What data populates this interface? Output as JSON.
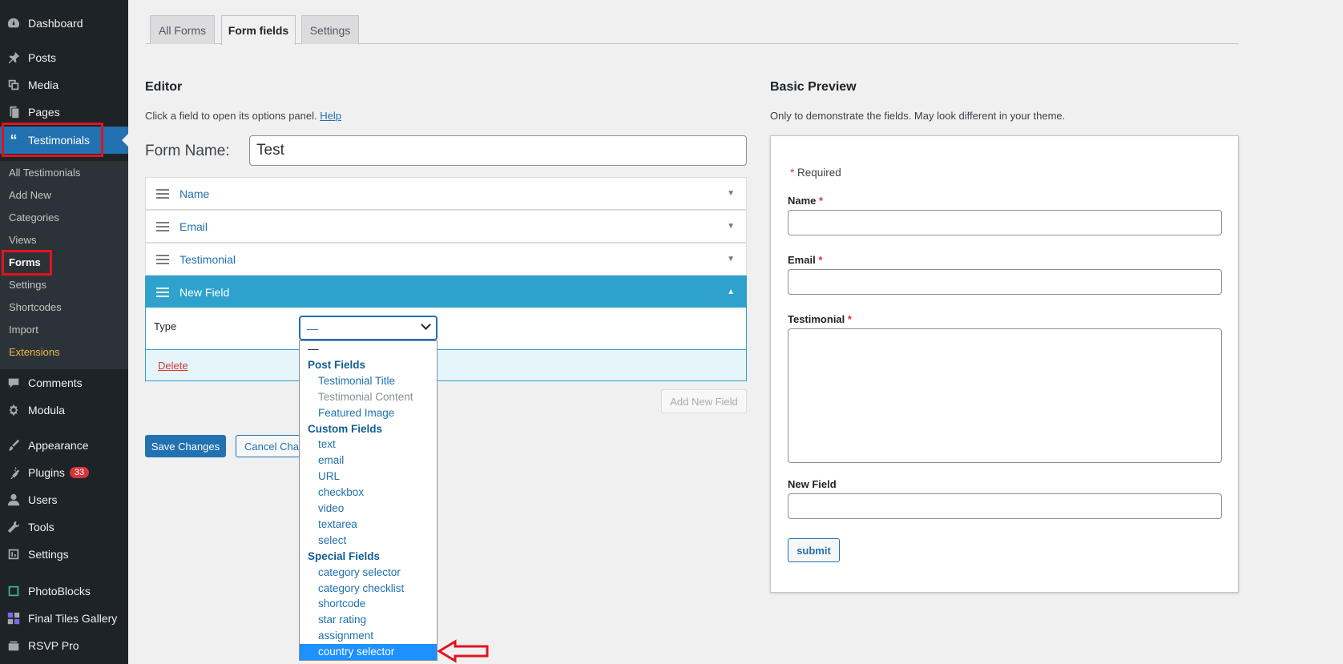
{
  "sidebar": {
    "menu": [
      {
        "label": "Dashboard",
        "icon": "dashboard-icon"
      },
      {
        "label": "Posts",
        "icon": "pin-icon"
      },
      {
        "label": "Media",
        "icon": "media-icon"
      },
      {
        "label": "Pages",
        "icon": "pages-icon"
      },
      {
        "label": "Testimonials",
        "icon": "quote-icon"
      },
      {
        "label": "Comments",
        "icon": "comment-icon"
      },
      {
        "label": "Modula",
        "icon": "gear-icon"
      },
      {
        "label": "Appearance",
        "icon": "brush-icon"
      },
      {
        "label": "Plugins",
        "icon": "plugin-icon",
        "badge": "33"
      },
      {
        "label": "Users",
        "icon": "user-icon"
      },
      {
        "label": "Tools",
        "icon": "wrench-icon"
      },
      {
        "label": "Settings",
        "icon": "settings-icon"
      },
      {
        "label": "PhotoBlocks",
        "icon": "photoblocks-icon"
      },
      {
        "label": "Final Tiles Gallery",
        "icon": "tiles-icon"
      },
      {
        "label": "RSVP Pro",
        "icon": "rsvp-icon"
      }
    ],
    "submenu": [
      "All Testimonials",
      "Add New",
      "Categories",
      "Views",
      "Forms",
      "Settings",
      "Shortcodes",
      "Import",
      "Extensions"
    ]
  },
  "tabs": [
    "All Forms",
    "Form fields",
    "Settings"
  ],
  "editor": {
    "title": "Editor",
    "description": "Click a field to open its options panel.",
    "help_link": "Help",
    "form_name_label": "Form Name:",
    "form_name_value": "Test",
    "fields": [
      "Name",
      "Email",
      "Testimonial",
      "New Field"
    ],
    "type_label": "Type",
    "type_value": "—",
    "delete_label": "Delete",
    "add_new_field": "Add New Field",
    "save_changes": "Save Changes",
    "cancel_changes": "Cancel Changes"
  },
  "dropdown": {
    "items": [
      {
        "kind": "empty",
        "label": "—"
      },
      {
        "kind": "grp",
        "label": "Post Fields"
      },
      {
        "kind": "opt",
        "label": "Testimonial Title"
      },
      {
        "kind": "opt disabled",
        "label": "Testimonial Content"
      },
      {
        "kind": "opt",
        "label": "Featured Image"
      },
      {
        "kind": "grp",
        "label": "Custom Fields"
      },
      {
        "kind": "opt",
        "label": "text"
      },
      {
        "kind": "opt",
        "label": "email"
      },
      {
        "kind": "opt",
        "label": "URL"
      },
      {
        "kind": "opt",
        "label": "checkbox"
      },
      {
        "kind": "opt",
        "label": "video"
      },
      {
        "kind": "opt",
        "label": "textarea"
      },
      {
        "kind": "opt",
        "label": "select"
      },
      {
        "kind": "grp",
        "label": "Special Fields"
      },
      {
        "kind": "opt",
        "label": "category selector"
      },
      {
        "kind": "opt",
        "label": "category checklist"
      },
      {
        "kind": "opt",
        "label": "shortcode"
      },
      {
        "kind": "opt",
        "label": "star rating"
      },
      {
        "kind": "opt",
        "label": "assignment"
      },
      {
        "kind": "opt selected",
        "label": "country selector"
      }
    ]
  },
  "preview": {
    "title": "Basic Preview",
    "description": "Only to demonstrate the fields. May look different in your theme.",
    "required_star": "*",
    "required_label": "Required",
    "labels": [
      "Name",
      "Email",
      "Testimonial",
      "New Field"
    ],
    "submit": "submit"
  },
  "colors": {
    "accent": "#2271b1",
    "open_field": "#2ea2cc",
    "highlight": "#e0141e",
    "sidebar": "#1d2327"
  }
}
